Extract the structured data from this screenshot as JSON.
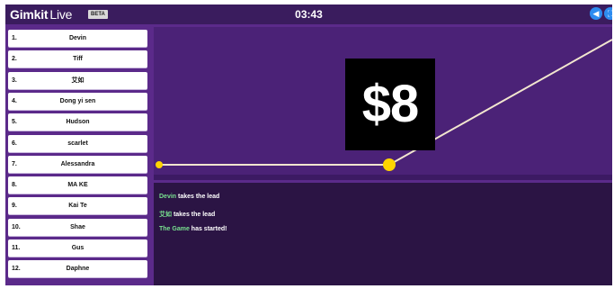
{
  "header": {
    "logo_main": "Gimkit",
    "logo_live": "Live",
    "badge": "BETA",
    "timer": "03:43",
    "buttons": [
      {
        "icon": "sound-icon"
      },
      {
        "icon": "fullscreen-icon"
      }
    ]
  },
  "leaderboard": [
    {
      "rank": "1.",
      "name": "Devin"
    },
    {
      "rank": "2.",
      "name": "Tiff"
    },
    {
      "rank": "3.",
      "name": "艾如"
    },
    {
      "rank": "4.",
      "name": "Dong yi sen"
    },
    {
      "rank": "5.",
      "name": "Hudson"
    },
    {
      "rank": "6.",
      "name": "scarlet"
    },
    {
      "rank": "7.",
      "name": "Alessandra"
    },
    {
      "rank": "8.",
      "name": "MA KE"
    },
    {
      "rank": "9.",
      "name": "Kai Te"
    },
    {
      "rank": "10.",
      "name": "Shae"
    },
    {
      "rank": "11.",
      "name": "Gus"
    },
    {
      "rank": "12.",
      "name": "Daphne"
    }
  ],
  "chart": {
    "cash_label": "$8",
    "line_color": "#f2e6cf",
    "dot_color": "#ffd400"
  },
  "feed": [
    {
      "actor": "Devin",
      "text": " takes the lead"
    },
    {
      "actor": "艾如",
      "text": " takes the lead"
    },
    {
      "actor": "The Game",
      "text": " has started!"
    }
  ],
  "colors": {
    "background": "#5b2a8a",
    "topbar": "#3a1c5e",
    "feed_actor": "#78e08f"
  }
}
